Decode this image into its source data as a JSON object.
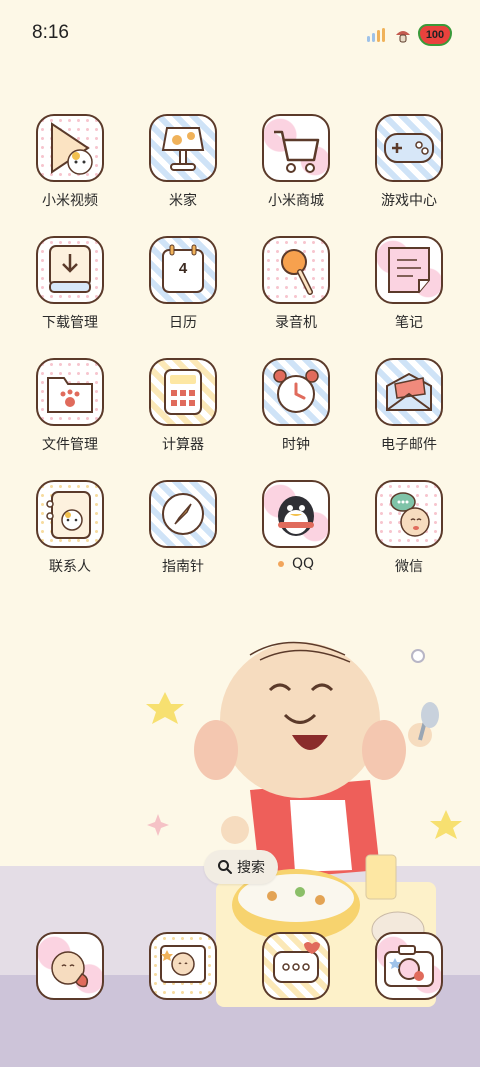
{
  "status_bar": {
    "time": "8:16",
    "battery": "100"
  },
  "apps": [
    {
      "label": "小米视频",
      "icon": "video-player-icon"
    },
    {
      "label": "米家",
      "icon": "smart-lamp-icon"
    },
    {
      "label": "小米商城",
      "icon": "shopping-cart-icon"
    },
    {
      "label": "游戏中心",
      "icon": "gamepad-icon"
    },
    {
      "label": "下载管理",
      "icon": "download-icon"
    },
    {
      "label": "日历",
      "icon": "calendar-icon"
    },
    {
      "label": "录音机",
      "icon": "microphone-icon"
    },
    {
      "label": "笔记",
      "icon": "notepad-icon"
    },
    {
      "label": "文件管理",
      "icon": "folder-icon"
    },
    {
      "label": "计算器",
      "icon": "calculator-icon"
    },
    {
      "label": "时钟",
      "icon": "alarm-clock-icon"
    },
    {
      "label": "电子邮件",
      "icon": "envelope-icon"
    },
    {
      "label": "联系人",
      "icon": "contacts-book-icon"
    },
    {
      "label": "指南针",
      "icon": "compass-icon"
    },
    {
      "label": "QQ",
      "icon": "penguin-icon"
    },
    {
      "label": "微信",
      "icon": "chat-bubble-icon"
    }
  ],
  "calendar_day": "4",
  "search": {
    "label": "搜索"
  },
  "dock": [
    {
      "icon": "phone-icon"
    },
    {
      "icon": "gallery-icon"
    },
    {
      "icon": "messages-icon"
    },
    {
      "icon": "camera-icon"
    }
  ],
  "colors": {
    "background": "#fdf8e7",
    "icon_border": "#5b3a2a",
    "battery_fill": "#e9423d",
    "notification_dot": "#f2a55b"
  }
}
